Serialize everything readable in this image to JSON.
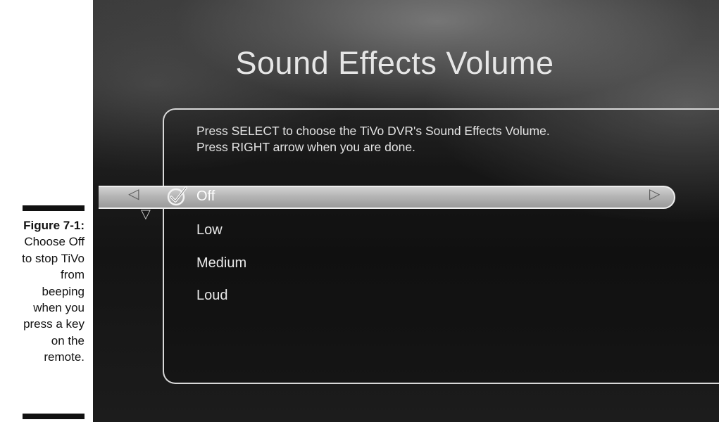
{
  "caption": {
    "label": "Figure 7-1:",
    "text": "Choose Off\nto stop TiVo\nfrom\nbeeping\nwhen you\npress a key\non the\nremote."
  },
  "screen": {
    "title": "Sound Effects Volume",
    "instructions": {
      "line1": "Press SELECT to choose the TiVo DVR's Sound Effects Volume.",
      "line2": "Press RIGHT arrow when you are done."
    },
    "options": [
      {
        "label": "Off",
        "selected": true
      },
      {
        "label": "Low",
        "selected": false
      },
      {
        "label": "Medium",
        "selected": false
      },
      {
        "label": "Loud",
        "selected": false
      }
    ],
    "icons": {
      "left": "left-arrow-icon",
      "right": "right-arrow-icon",
      "down": "down-arrow-icon",
      "check": "checkmark-icon"
    }
  },
  "colors": {
    "background": "#1a1a1a",
    "highlight": "#b5b5b5",
    "text": "#e8e8e8"
  }
}
